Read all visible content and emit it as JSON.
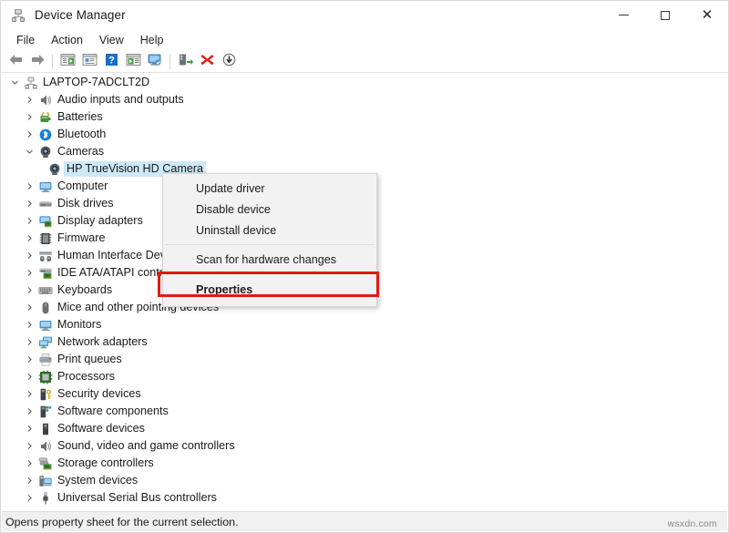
{
  "window": {
    "title": "Device Manager",
    "icon": "device-manager-icon",
    "controls": {
      "minimize": "–",
      "maximize": "□",
      "close": "✕"
    }
  },
  "menubar": {
    "items": [
      {
        "label": "File",
        "name": "menu-file"
      },
      {
        "label": "Action",
        "name": "menu-action"
      },
      {
        "label": "View",
        "name": "menu-view"
      },
      {
        "label": "Help",
        "name": "menu-help"
      }
    ]
  },
  "toolbar": {
    "buttons": [
      {
        "name": "back-icon",
        "title": "Back"
      },
      {
        "name": "forward-icon",
        "title": "Forward"
      },
      {
        "name": "separator-1",
        "title": ""
      },
      {
        "name": "show-hide-console-tree-icon",
        "title": "Show/Hide Console Tree"
      },
      {
        "name": "properties-window-icon",
        "title": "Properties"
      },
      {
        "name": "help-icon",
        "title": "Help"
      },
      {
        "name": "show-hide-action-pane-icon",
        "title": "Show/Hide Action Pane"
      },
      {
        "name": "display-device-icon",
        "title": "Display"
      },
      {
        "name": "separator-2",
        "title": ""
      },
      {
        "name": "update-driver-icon",
        "title": "Update driver"
      },
      {
        "name": "uninstall-device-icon",
        "title": "Uninstall device"
      },
      {
        "name": "disable-device-icon",
        "title": "Disable device"
      }
    ]
  },
  "tree": {
    "root": {
      "label": "LAPTOP-7ADCLT2D",
      "icon": "computer-root-icon",
      "expanded": true
    },
    "nodes": [
      {
        "label": "Audio inputs and outputs",
        "icon": "speaker-icon",
        "expanded": false,
        "level": 1
      },
      {
        "label": "Batteries",
        "icon": "battery-icon",
        "expanded": false,
        "level": 1
      },
      {
        "label": "Bluetooth",
        "icon": "bluetooth-icon",
        "expanded": false,
        "level": 1
      },
      {
        "label": "Cameras",
        "icon": "camera-icon",
        "expanded": true,
        "level": 1
      },
      {
        "label": "HP TrueVision HD Camera",
        "icon": "camera-icon",
        "expanded": null,
        "level": 2,
        "selected": true
      },
      {
        "label": "Computer",
        "icon": "monitor-icon",
        "expanded": false,
        "level": 1
      },
      {
        "label": "Disk drives",
        "icon": "disk-drive-icon",
        "expanded": false,
        "level": 1
      },
      {
        "label": "Display adapters",
        "icon": "display-adapter-icon",
        "expanded": false,
        "level": 1
      },
      {
        "label": "Firmware",
        "icon": "firmware-chip-icon",
        "expanded": false,
        "level": 1
      },
      {
        "label": "Human Interface Devices",
        "icon": "hid-icon",
        "expanded": false,
        "level": 1
      },
      {
        "label": "IDE ATA/ATAPI controllers",
        "icon": "ide-controller-icon",
        "expanded": false,
        "level": 1
      },
      {
        "label": "Keyboards",
        "icon": "keyboard-icon",
        "expanded": false,
        "level": 1
      },
      {
        "label": "Mice and other pointing devices",
        "icon": "mouse-icon",
        "expanded": false,
        "level": 1
      },
      {
        "label": "Monitors",
        "icon": "monitor-icon",
        "expanded": false,
        "level": 1
      },
      {
        "label": "Network adapters",
        "icon": "network-adapter-icon",
        "expanded": false,
        "level": 1
      },
      {
        "label": "Print queues",
        "icon": "printer-icon",
        "expanded": false,
        "level": 1
      },
      {
        "label": "Processors",
        "icon": "processor-icon",
        "expanded": false,
        "level": 1
      },
      {
        "label": "Security devices",
        "icon": "security-device-icon",
        "expanded": false,
        "level": 1
      },
      {
        "label": "Software components",
        "icon": "software-component-icon",
        "expanded": false,
        "level": 1
      },
      {
        "label": "Software devices",
        "icon": "software-device-icon",
        "expanded": false,
        "level": 1
      },
      {
        "label": "Sound, video and game controllers",
        "icon": "speaker-icon",
        "expanded": false,
        "level": 1
      },
      {
        "label": "Storage controllers",
        "icon": "storage-controller-icon",
        "expanded": false,
        "level": 1
      },
      {
        "label": "System devices",
        "icon": "system-device-icon",
        "expanded": false,
        "level": 1
      },
      {
        "label": "Universal Serial Bus controllers",
        "icon": "usb-icon",
        "expanded": false,
        "level": 1
      }
    ]
  },
  "context_menu": {
    "items": [
      {
        "label": "Update driver",
        "type": "item",
        "name": "context-update-driver"
      },
      {
        "label": "Disable device",
        "type": "item",
        "name": "context-disable-device"
      },
      {
        "label": "Uninstall device",
        "type": "item",
        "name": "context-uninstall-device"
      },
      {
        "label": "",
        "type": "separator",
        "name": "context-separator-1"
      },
      {
        "label": "Scan for hardware changes",
        "type": "item",
        "name": "context-scan-hardware"
      },
      {
        "label": "",
        "type": "separator",
        "name": "context-separator-2"
      },
      {
        "label": "Properties",
        "type": "item-bold",
        "name": "context-properties"
      }
    ]
  },
  "annotation": {
    "color": "#e01b12",
    "target": "Properties"
  },
  "statusbar": {
    "text": "Opens property sheet for the current selection."
  },
  "watermark": {
    "text": "wsxdn.com"
  },
  "colors": {
    "selection": "#cde8f7",
    "menu_bg": "#f2f2f2",
    "statusbar_bg": "#f0f0f0",
    "annotation_red": "#e01b12"
  }
}
